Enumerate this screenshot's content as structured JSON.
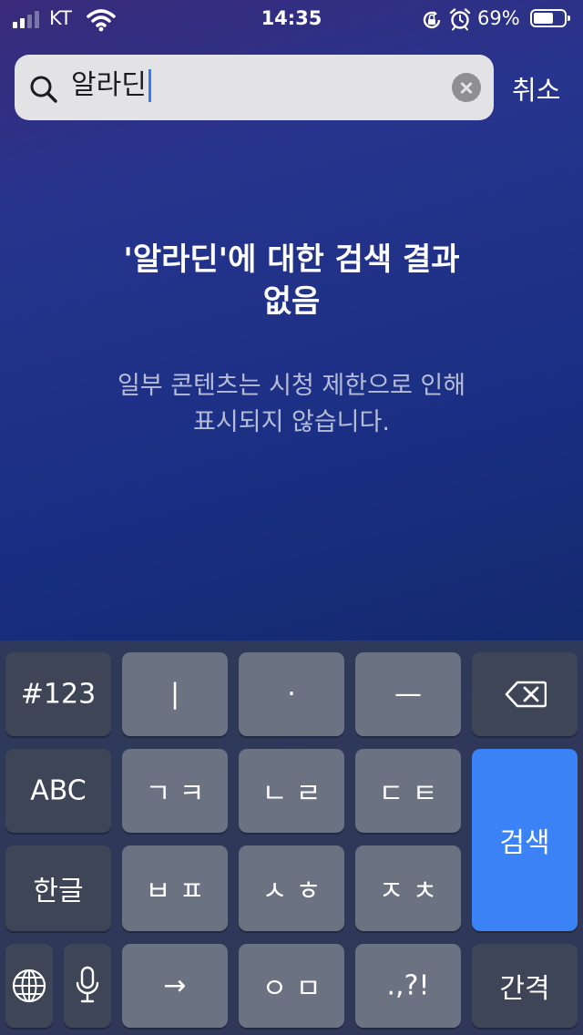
{
  "status": {
    "carrier": "KT",
    "time": "14:35",
    "battery_pct": "69%",
    "battery_level": 0.69,
    "signal_bars": 2,
    "icons": [
      "signal-icon",
      "wifi-icon",
      "orientation-lock-icon",
      "alarm-icon",
      "battery-icon"
    ]
  },
  "search": {
    "query": "알라딘",
    "cancel_label": "취소",
    "icons": [
      "search-icon",
      "clear-icon"
    ]
  },
  "results": {
    "title_line1": "'알라딘'에 대한 검색 결과",
    "title_line2": "없음",
    "sub_line1": "일부 콘텐츠는 시청 제한으로 인해",
    "sub_line2": "표시되지 않습니다."
  },
  "keyboard": {
    "row1": [
      "#123",
      "|",
      "·",
      "—"
    ],
    "row2": [
      "ABC",
      "ㄱ ㅋ",
      "ㄴ ㄹ",
      "ㄷ ㅌ"
    ],
    "row3": [
      "한글",
      "ㅂ ㅍ",
      "ㅅ ㅎ",
      "ㅈ ㅊ"
    ],
    "row4": [
      "→",
      "ㅇ ㅁ",
      ".,?!",
      "간격"
    ],
    "search_label": "검색",
    "icons": [
      "backspace-icon",
      "globe-icon",
      "microphone-icon"
    ],
    "accent_color": "#3a82f6"
  }
}
